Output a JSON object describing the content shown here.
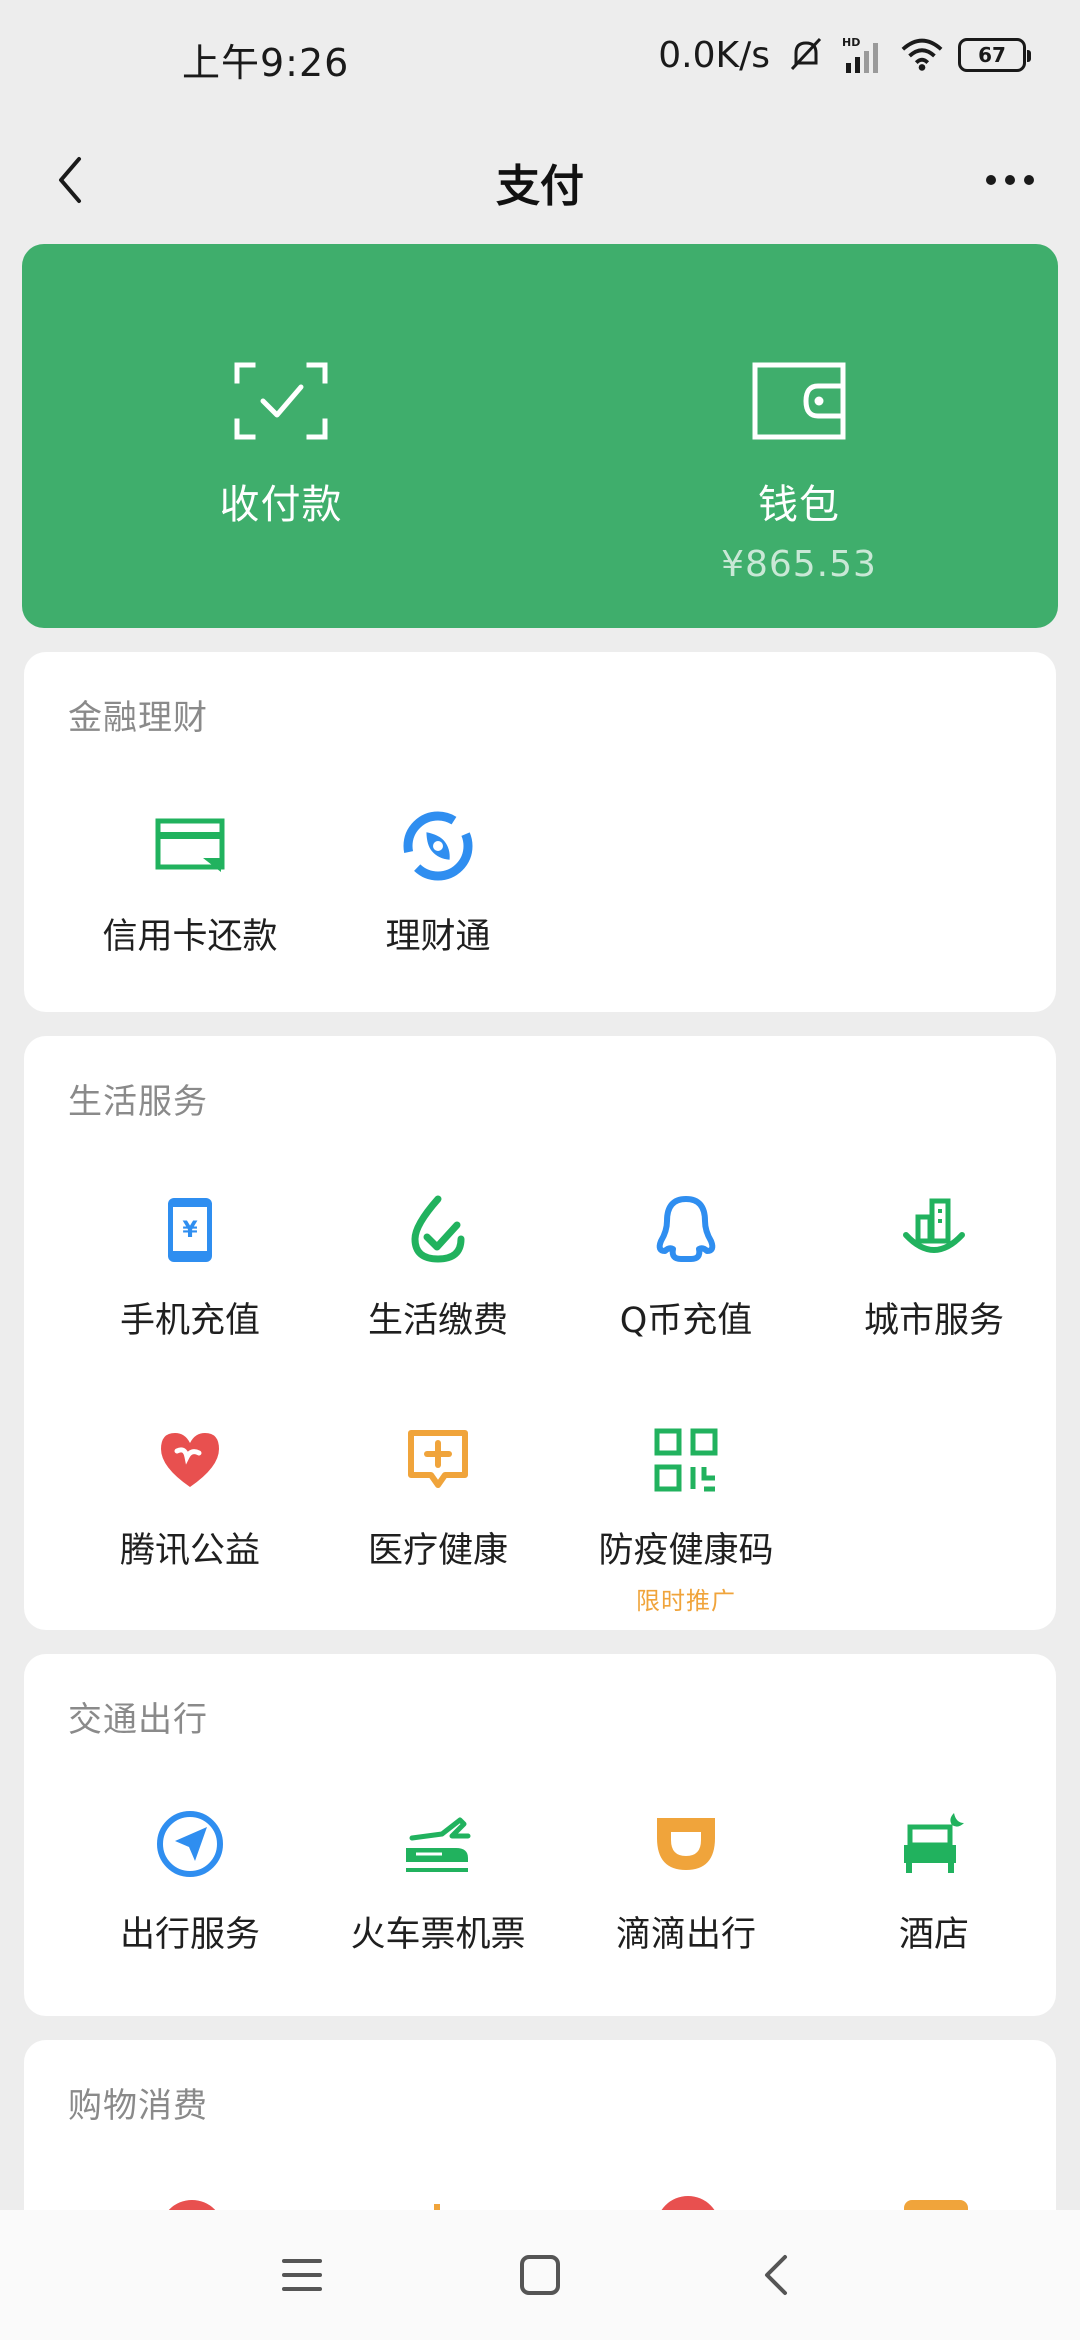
{
  "status_bar": {
    "time": "上午9:26",
    "net_speed": "0.0K/s",
    "battery": "67"
  },
  "nav": {
    "title": "支付"
  },
  "hero": {
    "left_label": "收付款",
    "right_label": "钱包",
    "balance": "¥865.53"
  },
  "sections": {
    "finance": {
      "title": "金融理财",
      "items": [
        {
          "label": "信用卡还款",
          "icon": "credit-card-icon"
        },
        {
          "label": "理财通",
          "icon": "wealth-icon"
        }
      ]
    },
    "life": {
      "title": "生活服务",
      "items": [
        {
          "label": "手机充值",
          "icon": "phone-topup-icon"
        },
        {
          "label": "生活缴费",
          "icon": "utility-bill-icon"
        },
        {
          "label": "Q币充值",
          "icon": "qq-penguin-icon"
        },
        {
          "label": "城市服务",
          "icon": "city-service-icon"
        },
        {
          "label": "腾讯公益",
          "icon": "charity-heart-icon"
        },
        {
          "label": "医疗健康",
          "icon": "medical-icon"
        },
        {
          "label": "防疫健康码",
          "icon": "qr-code-icon",
          "sub": "限时推广"
        }
      ]
    },
    "transport": {
      "title": "交通出行",
      "items": [
        {
          "label": "出行服务",
          "icon": "compass-icon"
        },
        {
          "label": "火车票机票",
          "icon": "train-plane-icon"
        },
        {
          "label": "滴滴出行",
          "icon": "didi-icon"
        },
        {
          "label": "酒店",
          "icon": "hotel-bed-icon"
        }
      ]
    },
    "shopping": {
      "title": "购物消费"
    }
  },
  "colors": {
    "brand_green": "#3fae6c",
    "icon_green": "#21b25e",
    "icon_blue": "#2f8ef0",
    "icon_orange": "#f0a43b",
    "icon_red": "#e8504f"
  }
}
